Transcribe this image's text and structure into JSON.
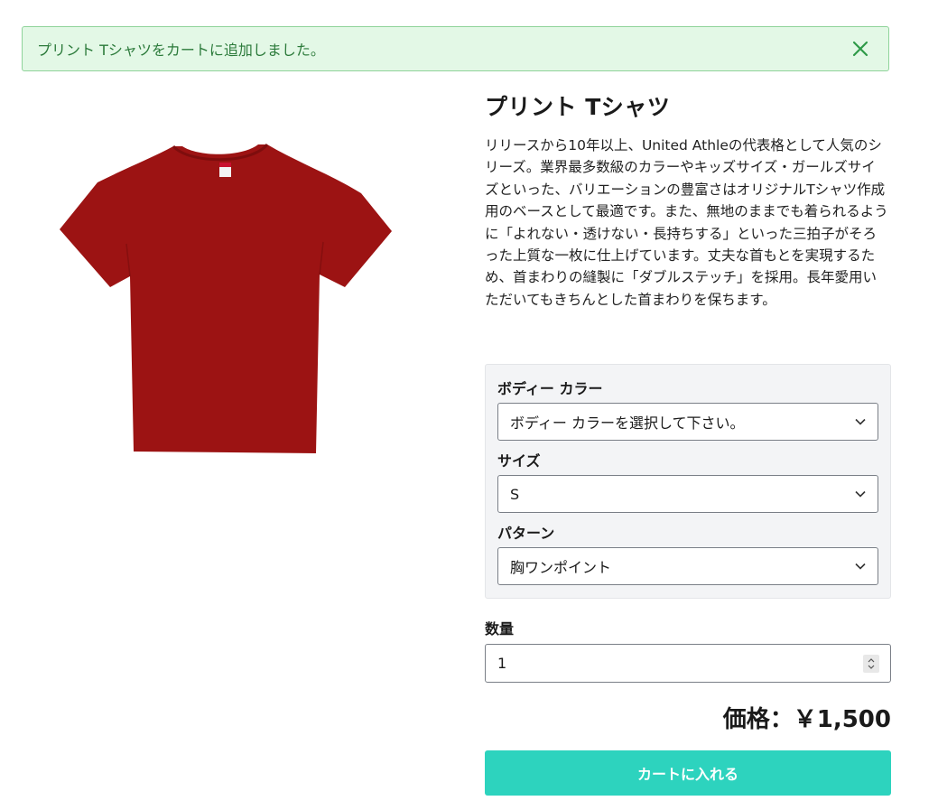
{
  "alert": {
    "message": "プリント Tシャツをカートに追加しました。",
    "close_icon": "close-icon"
  },
  "product": {
    "title": "プリント Tシャツ",
    "description": "リリースから10年以上、United Athleの代表格として人気のシリーズ。業界最多数級のカラーやキッズサイズ・ガールズサイズといった、バリエーションの豊富さはオリジナルTシャツ作成用のベースとして最適です。また、無地のままでも着られるように「よれない・透けない・長持ちする」といった三拍子がそろった上質な一枚に仕上げています。丈夫な首もとを実現するため、首まわりの縫製に「ダブルステッチ」を採用。長年愛用いただいてもきちんとした首まわりを保ちます。",
    "image_color": "#9c1313"
  },
  "options": {
    "color_label": "ボディー カラー",
    "color_value": "ボディー カラーを選択して下さい。",
    "size_label": "サイズ",
    "size_value": "S",
    "pattern_label": "パターン",
    "pattern_value": "胸ワンポイント"
  },
  "quantity": {
    "label": "数量",
    "value": "1"
  },
  "price": "価格：￥1,500",
  "cart_button": "カートに入れる",
  "colors": {
    "accent": "#2dd3be",
    "alert_bg": "#e3f8e6",
    "alert_text": "#2b7a3a"
  }
}
